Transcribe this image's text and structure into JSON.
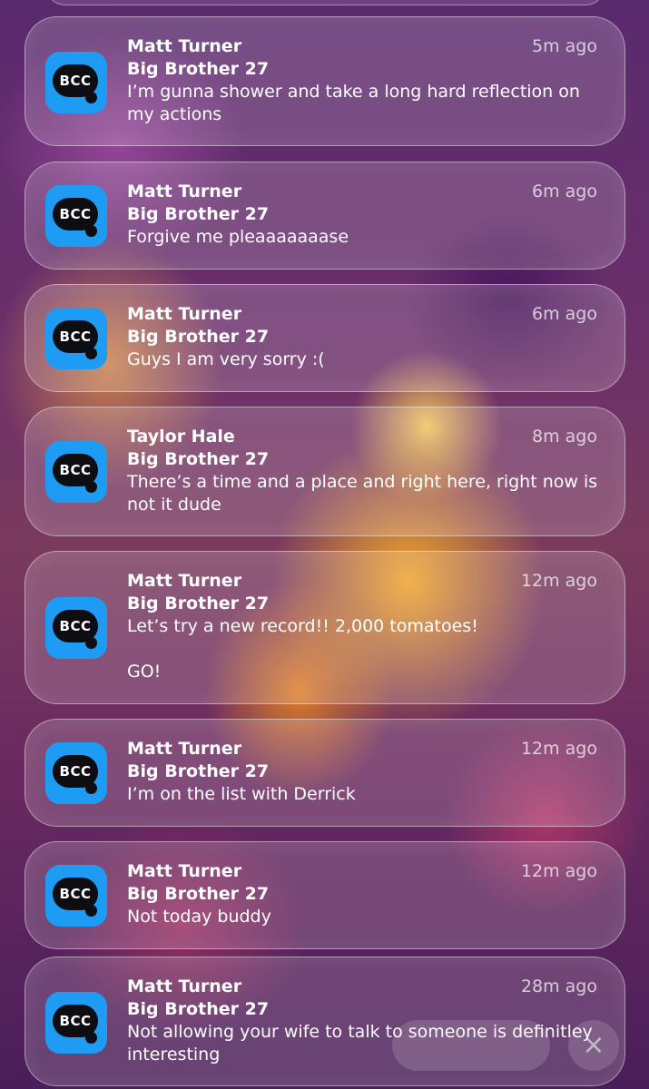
{
  "notifications": [
    {
      "sender": "Matt Turner",
      "subtitle": "Big Brother 27",
      "message": "I’m gunna shower and take a long hard reflection on my actions",
      "time": "5m ago",
      "app_icon_label": "BCC"
    },
    {
      "sender": "Matt Turner",
      "subtitle": "Big Brother 27",
      "message": "Forgive me pleaaaaaaase",
      "time": "6m ago",
      "app_icon_label": "BCC"
    },
    {
      "sender": "Matt Turner",
      "subtitle": "Big Brother 27",
      "message": "Guys I am very sorry :(",
      "time": "6m ago",
      "app_icon_label": "BCC"
    },
    {
      "sender": "Taylor Hale",
      "subtitle": "Big Brother 27",
      "message": "There’s a time and a place and right here, right now is not it dude",
      "time": "8m ago",
      "app_icon_label": "BCC"
    },
    {
      "sender": "Matt Turner",
      "subtitle": "Big Brother 27",
      "message": "Let’s try a new record!! 2,000 tomatoes!\n\nGO!",
      "time": "12m ago",
      "app_icon_label": "BCC"
    },
    {
      "sender": "Matt Turner",
      "subtitle": "Big Brother 27",
      "message": "I’m on the list with Derrick",
      "time": "12m ago",
      "app_icon_label": "BCC"
    },
    {
      "sender": "Matt Turner",
      "subtitle": "Big Brother 27",
      "message": "Not today buddy",
      "time": "12m ago",
      "app_icon_label": "BCC"
    },
    {
      "sender": "Matt Turner",
      "subtitle": "Big Brother 27",
      "message": "Not allowing your wife to talk to someone is definitley interesting",
      "time": "28m ago",
      "app_icon_label": "BCC"
    }
  ],
  "colors": {
    "app_icon_background": "#1e9bf2",
    "app_icon_bubble": "#0d0d12"
  }
}
